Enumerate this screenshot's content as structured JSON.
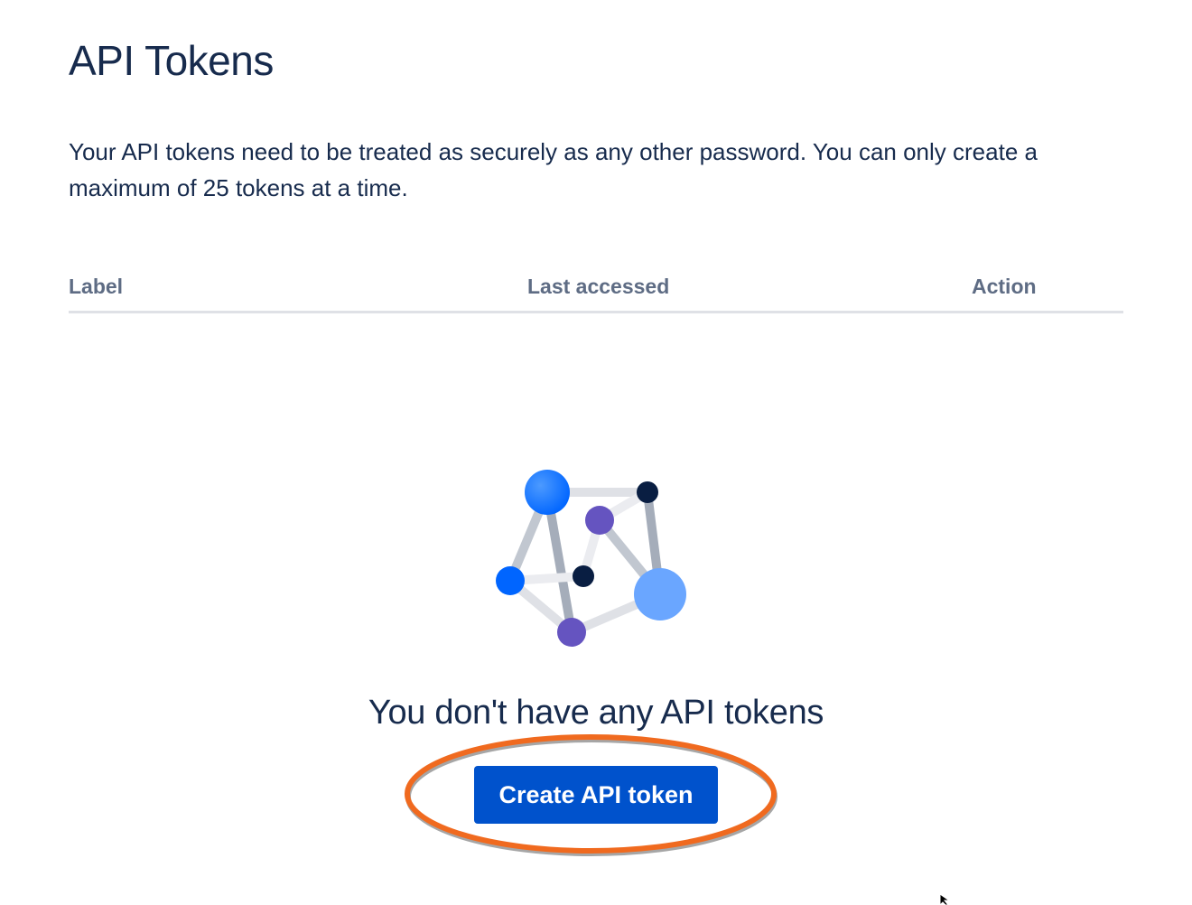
{
  "page": {
    "title": "API Tokens",
    "description": "Your API tokens need to be treated as securely as any other password. You can only create a maximum of 25 tokens at a time."
  },
  "table": {
    "columns": [
      "Label",
      "Last accessed",
      "Action"
    ],
    "rows": []
  },
  "empty_state": {
    "illustration_icon": "network-nodes-icon",
    "title": "You don't have any API tokens",
    "button_label": "Create API token"
  },
  "annotation": {
    "highlight": "orange-ellipse-around-create-button",
    "color": "#f06a1f"
  },
  "colors": {
    "primary_button": "#0052cc",
    "heading": "#172b4d",
    "subtle_text": "#5e6c84",
    "divider": "#dfe1e6"
  }
}
